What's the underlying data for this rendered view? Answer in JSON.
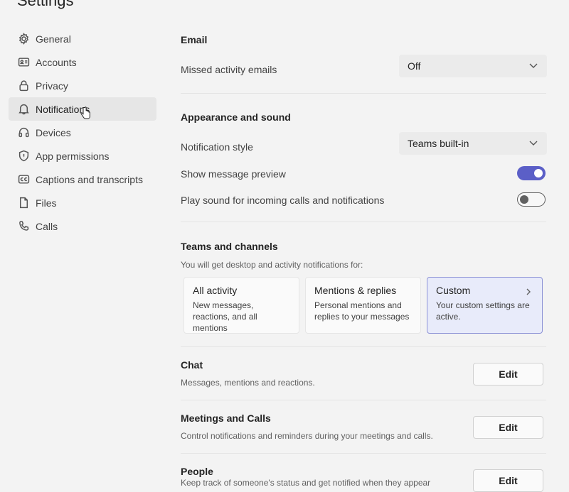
{
  "window": {
    "title": "Settings"
  },
  "sidebar": {
    "items": [
      {
        "label": "General",
        "icon": "gear-icon"
      },
      {
        "label": "Accounts",
        "icon": "id-card-icon"
      },
      {
        "label": "Privacy",
        "icon": "lock-icon"
      },
      {
        "label": "Notifications",
        "icon": "bell-icon",
        "active": true
      },
      {
        "label": "Devices",
        "icon": "headset-icon"
      },
      {
        "label": "App permissions",
        "icon": "shield-icon"
      },
      {
        "label": "Captions and transcripts",
        "icon": "cc-icon"
      },
      {
        "label": "Files",
        "icon": "file-icon"
      },
      {
        "label": "Calls",
        "icon": "phone-icon"
      }
    ]
  },
  "email": {
    "title": "Email",
    "missed_label": "Missed activity emails",
    "missed_value": "Off"
  },
  "appearance": {
    "title": "Appearance and sound",
    "style_label": "Notification style",
    "style_value": "Teams built-in",
    "preview_label": "Show message preview",
    "preview_on": true,
    "sound_label": "Play sound for incoming calls and notifications",
    "sound_on": false
  },
  "teams": {
    "title": "Teams and channels",
    "subtitle": "You will get desktop and activity notifications for:",
    "cards": [
      {
        "title": "All activity",
        "desc": "New messages, reactions, and all mentions",
        "selected": false
      },
      {
        "title": "Mentions & replies",
        "desc": "Personal mentions and replies to your messages",
        "selected": false
      },
      {
        "title": "Custom",
        "desc": "Your custom settings are active.",
        "selected": true
      }
    ]
  },
  "chat": {
    "title": "Chat",
    "desc": "Messages, mentions and reactions.",
    "button": "Edit"
  },
  "meetings": {
    "title": "Meetings and Calls",
    "desc": "Control notifications and reminders during your meetings and calls.",
    "button": "Edit"
  },
  "people": {
    "title": "People",
    "desc": "Keep track of someone's status and get notified when they appear",
    "button": "Edit"
  },
  "colors": {
    "accent": "#5b5fc7",
    "selected_card_bg": "#e8ebfa",
    "background": "#f3f3f3"
  }
}
